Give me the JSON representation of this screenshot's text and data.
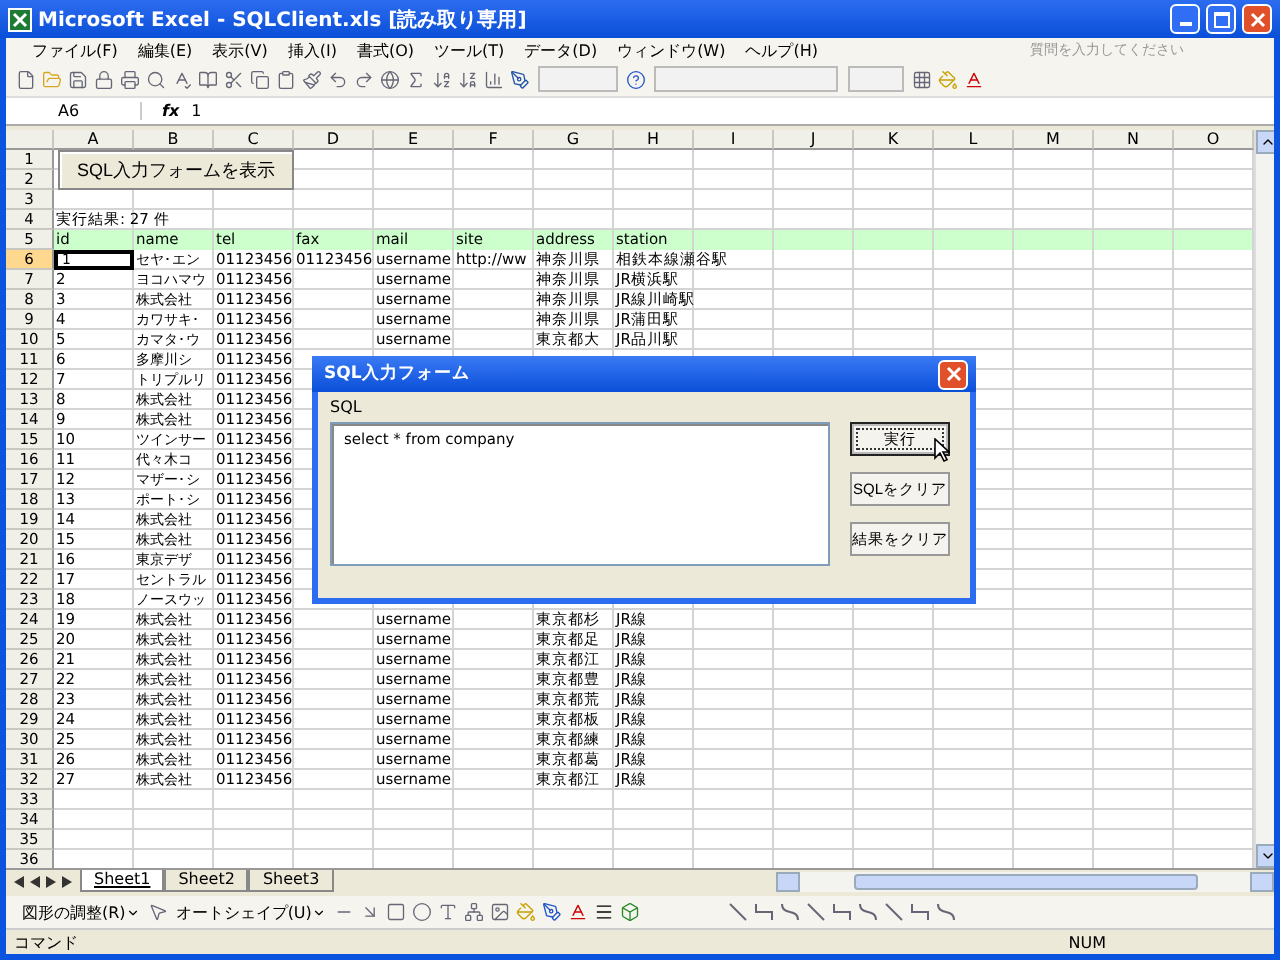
{
  "window": {
    "title": "Microsoft Excel - SQLClient.xls  [読み取り専用]"
  },
  "menu": [
    "ファイル(F)",
    "編集(E)",
    "表示(V)",
    "挿入(I)",
    "書式(O)",
    "ツール(T)",
    "データ(D)",
    "ウィンドウ(W)",
    "ヘルプ(H)"
  ],
  "help_search": {
    "placeholder": "質問を入力してください"
  },
  "formula_bar": {
    "name_box": "A6",
    "fx_label": "fx",
    "value": "1"
  },
  "sheet": {
    "columns": [
      "A",
      "B",
      "C",
      "D",
      "E",
      "F",
      "G",
      "H",
      "I",
      "J",
      "K",
      "L",
      "M",
      "N",
      "O"
    ],
    "button": "SQL入力フォームを表示",
    "rows": [
      {
        "number": "1",
        "highlighted": false,
        "active": false,
        "cells": {}
      },
      {
        "number": "2",
        "highlighted": false,
        "active": false,
        "cells": {}
      },
      {
        "number": "3",
        "highlighted": false,
        "active": false,
        "cells": {}
      },
      {
        "number": "4",
        "highlighted": false,
        "active": false,
        "cells": {
          "A": "実行結果: 27 件"
        }
      },
      {
        "number": "5",
        "highlighted": true,
        "active": false,
        "cells": {
          "A": "id",
          "B": "name",
          "C": "tel",
          "D": "fax",
          "E": "mail",
          "F": "site",
          "G": "address",
          "H": "station"
        }
      },
      {
        "number": "6",
        "highlighted": false,
        "active": true,
        "cells": {
          "A": "1",
          "B": "セヤ･エン",
          "C": "01123456",
          "D": "01123456",
          "E": "username",
          "F": "http://ww",
          "G": "神奈川県",
          "H": "相鉄本線瀬谷駅"
        }
      },
      {
        "number": "7",
        "highlighted": false,
        "active": false,
        "cells": {
          "A": "2",
          "B": "ヨコハマウ",
          "C": "01123456",
          "E": "username",
          "G": "神奈川県",
          "H": "JR横浜駅"
        }
      },
      {
        "number": "8",
        "highlighted": false,
        "active": false,
        "cells": {
          "A": "3",
          "B": "株式会社",
          "C": "01123456",
          "E": "username",
          "G": "神奈川県",
          "H": "JR線川崎駅"
        }
      },
      {
        "number": "9",
        "highlighted": false,
        "active": false,
        "cells": {
          "A": "4",
          "B": "カワサキ･",
          "C": "01123456",
          "E": "username",
          "G": "神奈川県",
          "H": "JR蒲田駅"
        }
      },
      {
        "number": "10",
        "highlighted": false,
        "active": false,
        "cells": {
          "A": "5",
          "B": "カマタ･ウ",
          "C": "01123456",
          "E": "username",
          "G": "東京都大",
          "H": "JR品川駅"
        }
      },
      {
        "number": "11",
        "highlighted": false,
        "active": false,
        "cells": {
          "A": "6",
          "B": "多摩川シ",
          "C": "01123456"
        }
      },
      {
        "number": "12",
        "highlighted": false,
        "active": false,
        "cells": {
          "A": "7",
          "B": "トリプルリ",
          "C": "01123456"
        }
      },
      {
        "number": "13",
        "highlighted": false,
        "active": false,
        "cells": {
          "A": "8",
          "B": "株式会社",
          "C": "01123456"
        }
      },
      {
        "number": "14",
        "highlighted": false,
        "active": false,
        "cells": {
          "A": "9",
          "B": "株式会社",
          "C": "01123456"
        }
      },
      {
        "number": "15",
        "highlighted": false,
        "active": false,
        "cells": {
          "A": "10",
          "B": "ツインサー",
          "C": "01123456"
        }
      },
      {
        "number": "16",
        "highlighted": false,
        "active": false,
        "cells": {
          "A": "11",
          "B": "代々木コ",
          "C": "01123456"
        }
      },
      {
        "number": "17",
        "highlighted": false,
        "active": false,
        "cells": {
          "A": "12",
          "B": "マザー･シ",
          "C": "01123456"
        }
      },
      {
        "number": "18",
        "highlighted": false,
        "active": false,
        "cells": {
          "A": "13",
          "B": "ポート･シ",
          "C": "01123456"
        }
      },
      {
        "number": "19",
        "highlighted": false,
        "active": false,
        "cells": {
          "A": "14",
          "B": "株式会社",
          "C": "01123456"
        }
      },
      {
        "number": "20",
        "highlighted": false,
        "active": false,
        "cells": {
          "A": "15",
          "B": "株式会社",
          "C": "01123456"
        }
      },
      {
        "number": "21",
        "highlighted": false,
        "active": false,
        "cells": {
          "A": "16",
          "B": "東京デザ",
          "C": "01123456"
        }
      },
      {
        "number": "22",
        "highlighted": false,
        "active": false,
        "cells": {
          "A": "17",
          "B": "セントラル",
          "C": "01123456"
        }
      },
      {
        "number": "23",
        "highlighted": false,
        "active": false,
        "cells": {
          "A": "18",
          "B": "ノースウッ",
          "C": "01123456"
        }
      },
      {
        "number": "24",
        "highlighted": false,
        "active": false,
        "cells": {
          "A": "19",
          "B": "株式会社",
          "C": "01123456",
          "E": "username",
          "G": "東京都杉",
          "H": "JR線"
        }
      },
      {
        "number": "25",
        "highlighted": false,
        "active": false,
        "cells": {
          "A": "20",
          "B": "株式会社",
          "C": "01123456",
          "E": "username",
          "G": "東京都足",
          "H": "JR線"
        }
      },
      {
        "number": "26",
        "highlighted": false,
        "active": false,
        "cells": {
          "A": "21",
          "B": "株式会社",
          "C": "01123456",
          "E": "username",
          "G": "東京都江",
          "H": "JR線"
        }
      },
      {
        "number": "27",
        "highlighted": false,
        "active": false,
        "cells": {
          "A": "22",
          "B": "株式会社",
          "C": "01123456",
          "E": "username",
          "G": "東京都豊",
          "H": "JR線"
        }
      },
      {
        "number": "28",
        "highlighted": false,
        "active": false,
        "cells": {
          "A": "23",
          "B": "株式会社",
          "C": "01123456",
          "E": "username",
          "G": "東京都荒",
          "H": "JR線"
        }
      },
      {
        "number": "29",
        "highlighted": false,
        "active": false,
        "cells": {
          "A": "24",
          "B": "株式会社",
          "C": "01123456",
          "E": "username",
          "G": "東京都板",
          "H": "JR線"
        }
      },
      {
        "number": "30",
        "highlighted": false,
        "active": false,
        "cells": {
          "A": "25",
          "B": "株式会社",
          "C": "01123456",
          "E": "username",
          "G": "東京都練",
          "H": "JR線"
        }
      },
      {
        "number": "31",
        "highlighted": false,
        "active": false,
        "cells": {
          "A": "26",
          "B": "株式会社",
          "C": "01123456",
          "E": "username",
          "G": "東京都葛",
          "H": "JR線"
        }
      },
      {
        "number": "32",
        "highlighted": false,
        "active": false,
        "cells": {
          "A": "27",
          "B": "株式会社",
          "C": "01123456",
          "E": "username",
          "G": "東京都江",
          "H": "JR線"
        }
      },
      {
        "number": "33",
        "highlighted": false,
        "active": false,
        "cells": {}
      },
      {
        "number": "34",
        "highlighted": false,
        "active": false,
        "cells": {}
      },
      {
        "number": "35",
        "highlighted": false,
        "active": false,
        "cells": {}
      },
      {
        "number": "36",
        "highlighted": false,
        "active": false,
        "cells": {}
      }
    ]
  },
  "sheet_tabs": [
    {
      "label": "Sheet1",
      "selected": true
    },
    {
      "label": "Sheet2",
      "selected": false
    },
    {
      "label": "Sheet3",
      "selected": false
    }
  ],
  "drawing_toolbar": {
    "arrange": "図形の調整(R)",
    "autoshapes": "オートシェイプ(U)"
  },
  "status_bar": {
    "mode": "コマンド",
    "indicator": "NUM"
  },
  "dialog": {
    "title": "SQL入力フォーム",
    "label": "SQL",
    "query": "select * from company",
    "buttons": [
      {
        "label": "実行",
        "focused": true
      },
      {
        "label": "SQLをクリア",
        "focused": false
      },
      {
        "label": "結果をクリア",
        "focused": false
      }
    ]
  }
}
